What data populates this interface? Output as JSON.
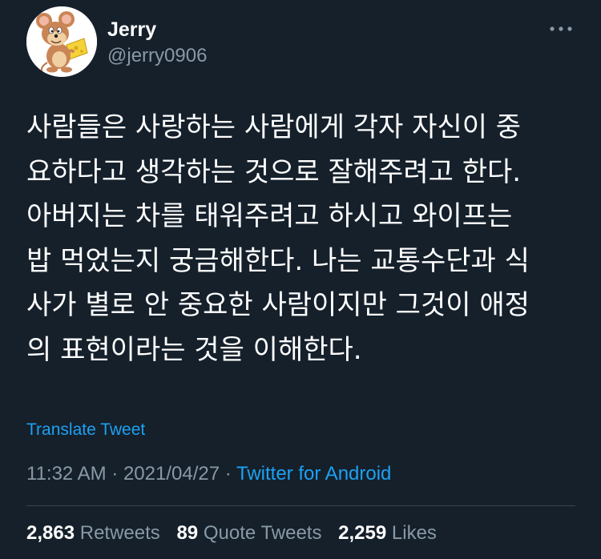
{
  "colors": {
    "background": "#15202b",
    "text_primary": "#ffffff",
    "text_secondary": "#8899a6",
    "accent": "#1da1f2",
    "divider": "#38444d"
  },
  "author": {
    "display_name": "Jerry",
    "handle": "@jerry0906",
    "avatar_icon": "jerry-mouse-avatar"
  },
  "more_icon": "more-horizontal-icon",
  "tweet": {
    "text": "사람들은 사랑하는 사람에게 각자 자신이 중\n요하다고 생각하는 것으로 잘해주려고 한다.\n아버지는 차를 태워주려고 하시고 와이프는\n밥 먹었는지 궁금해한다. 나는 교통수단과 식\n사가 별로 안 중요한 사람이지만 그것이 애정\n의 표현이라는 것을 이해한다."
  },
  "translate_label": "Translate Tweet",
  "meta": {
    "time": "11:32 AM",
    "separator": " · ",
    "date": "2021/04/27",
    "source": "Twitter for Android"
  },
  "stats": [
    {
      "count": "2,863",
      "label": "Retweets"
    },
    {
      "count": "89",
      "label": "Quote Tweets"
    },
    {
      "count": "2,259",
      "label": "Likes"
    }
  ]
}
